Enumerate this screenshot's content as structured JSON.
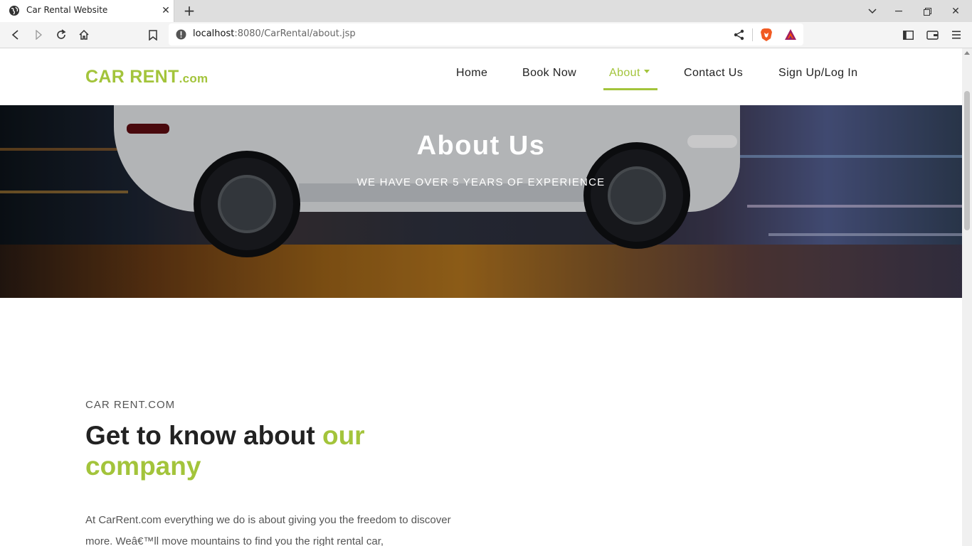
{
  "browser": {
    "tab_title": "Car Rental Website",
    "url_host": "localhost",
    "url_path": ":8080/CarRental/about.jsp"
  },
  "site": {
    "logo_main": "CAR RENT",
    "logo_suffix": ".com",
    "nav": {
      "home": "Home",
      "book_now": "Book Now",
      "about": "About",
      "contact": "Contact Us",
      "signup": "Sign Up/Log In"
    },
    "accent_color": "#a3c43b"
  },
  "hero": {
    "title": "About Us",
    "subtitle": "WE HAVE OVER 5 YEARS OF EXPERIENCE"
  },
  "about": {
    "eyebrow": "CAR RENT.COM",
    "heading_main": "Get to know about ",
    "heading_accent": "our company",
    "body": "At CarRent.com everything we do is about giving you the freedom to discover more. Weâ€™ll move mountains to find you the right rental car,"
  }
}
